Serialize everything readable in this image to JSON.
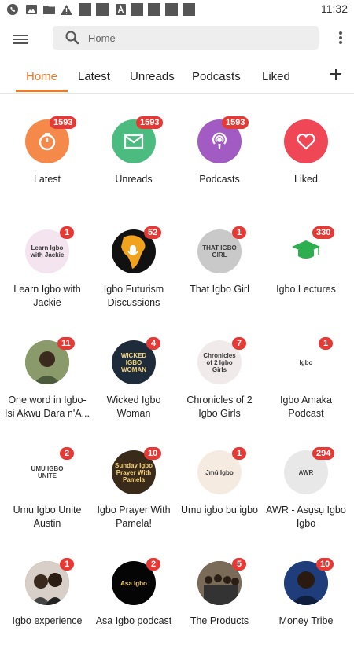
{
  "status_bar": {
    "time": "11:32"
  },
  "search": {
    "placeholder": "Home"
  },
  "tabs": [
    {
      "label": "Home",
      "active": true
    },
    {
      "label": "Latest"
    },
    {
      "label": "Unreads"
    },
    {
      "label": "Podcasts"
    },
    {
      "label": "Liked"
    }
  ],
  "feeds": [
    {
      "label": [
        "Latest"
      ],
      "badge": "1593",
      "icon": "timer-icon",
      "color": "#f5894a"
    },
    {
      "label": [
        "Unreads"
      ],
      "badge": "1593",
      "icon": "mail-icon",
      "color": "#4cbb7f"
    },
    {
      "label": [
        "Podcasts"
      ],
      "badge": "1593",
      "icon": "podcast-icon",
      "color": "#a25bc2"
    },
    {
      "label": [
        "Liked"
      ],
      "badge": "",
      "icon": "heart-icon",
      "color": "#ef4756"
    },
    {
      "label": [
        "Learn Igbo with",
        "Jackie"
      ],
      "badge": "1",
      "icon": "learn-igbo-jackie-cover",
      "color": "#f4e4f0",
      "cover_text": "Learn Igbo with Jackie"
    },
    {
      "label": [
        "Igbo Futurism",
        "Discussions"
      ],
      "badge": "52",
      "icon": "africa-microphone-cover",
      "color": "#111111"
    },
    {
      "label": [
        "That Igbo Girl"
      ],
      "badge": "1",
      "icon": "that-igbo-girl-cover",
      "color": "#c9c9c9",
      "cover_text": "THAT IGBO GIRL"
    },
    {
      "label": [
        "Igbo Lectures"
      ],
      "badge": "330",
      "icon": "graduation-cap-cover",
      "color": "#ffffff",
      "cover_text": "IGBO LECTURES"
    },
    {
      "label": [
        "One word in Igbo-",
        "Isi Akwu Dara n'A..."
      ],
      "badge": "11",
      "icon": "portrait-cover",
      "color": "#7a8a5a"
    },
    {
      "label": [
        "Wicked Igbo",
        "Woman"
      ],
      "badge": "4",
      "icon": "wicked-igbo-woman-cover",
      "color": "#1d2b3a",
      "cover_text": "WICKED IGBO WOMAN"
    },
    {
      "label": [
        "Chronicles of 2",
        "Igbo Girls"
      ],
      "badge": "7",
      "icon": "chronicles-cover",
      "color": "#f1eaea",
      "cover_text": "Chronicles of 2 Igbo Girls"
    },
    {
      "label": [
        "Igbo Amaka",
        "Podcast"
      ],
      "badge": "1",
      "icon": "igbo-amaka-cover",
      "color": "#ffffff",
      "cover_text": "Igbo"
    },
    {
      "label": [
        "Umu Igbo Unite",
        "Austin"
      ],
      "badge": "2",
      "icon": "umu-igbo-unite-cover",
      "color": "#ffffff",
      "cover_text": "UMU IGBO UNITE"
    },
    {
      "label": [
        "Igbo Prayer With",
        "Pamela!"
      ],
      "badge": "10",
      "icon": "prayer-cover",
      "color": "#3a2a1a",
      "cover_text": "Sunday Igbo Prayer With Pamela"
    },
    {
      "label": [
        "Umu igbo bu igbo"
      ],
      "badge": "1",
      "icon": "umu-igbo-cover",
      "color": "#f6ebe0",
      "cover_text": "Jmú Igbo"
    },
    {
      "label": [
        "AWR - Asụsụ Igbo",
        "Igbo"
      ],
      "badge": "294",
      "icon": "awr-cover",
      "color": "#e8e8e8",
      "cover_text": "AWR"
    },
    {
      "label": [
        "Igbo experience"
      ],
      "badge": "1",
      "icon": "portrait-pair-cover",
      "color": "#6a5a4a"
    },
    {
      "label": [
        "Asa Igbo podcast"
      ],
      "badge": "2",
      "icon": "asa-igbo-cover",
      "color": "#050505",
      "cover_text": "Asa Igbo"
    },
    {
      "label": [
        "The Products"
      ],
      "badge": "5",
      "icon": "group-photo-cover",
      "color": "#5a4a3a"
    },
    {
      "label": [
        "Money Tribe"
      ],
      "badge": "10",
      "icon": "portrait-man-cover",
      "color": "#1f3d7a"
    }
  ]
}
